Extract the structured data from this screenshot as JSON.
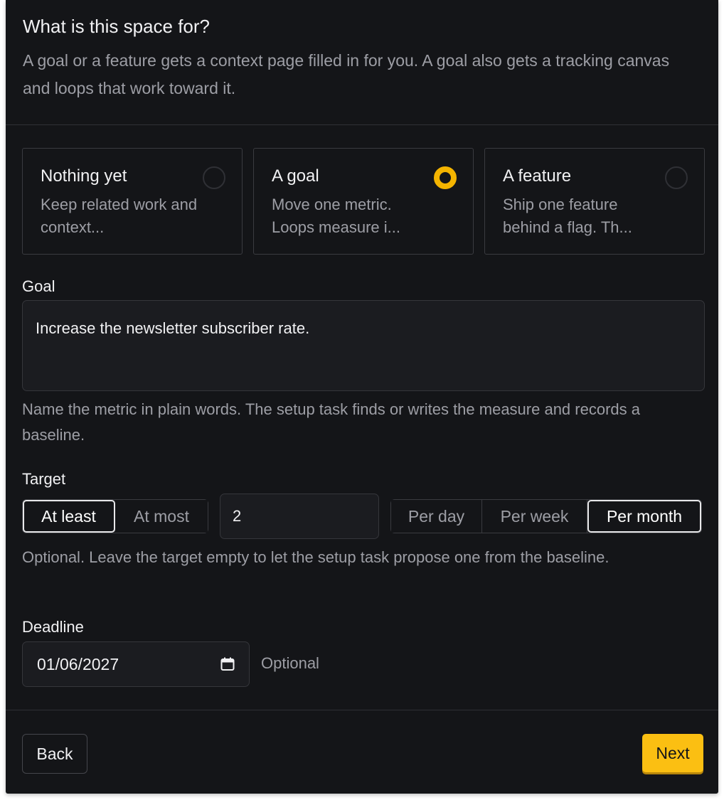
{
  "header": {
    "title": "What is this space for?",
    "subtitle": "A goal or a feature gets a context page filled in for you. A goal also gets a tracking canvas and loops that work toward it."
  },
  "options": [
    {
      "title": "Nothing yet",
      "desc": "Keep related work and context...",
      "selected": false
    },
    {
      "title": "A goal",
      "desc": "Move one metric. Loops measure i...",
      "selected": true
    },
    {
      "title": "A feature",
      "desc": "Ship one feature behind a flag. Th...",
      "selected": false
    }
  ],
  "goal": {
    "label": "Goal",
    "value": "Increase the newsletter subscriber rate.",
    "help": "Name the metric in plain words. The setup task finds or writes the measure and records a baseline."
  },
  "target": {
    "label": "Target",
    "comparators": [
      "At least",
      "At most"
    ],
    "selected_comparator": "At least",
    "value": "2",
    "periods": [
      "Per day",
      "Per week",
      "Per month"
    ],
    "selected_period": "Per month",
    "help": "Optional. Leave the target empty to let the setup task propose one from the baseline."
  },
  "deadline": {
    "label": "Deadline",
    "value": "01/06/2027",
    "note": "Optional"
  },
  "footer": {
    "back_label": "Back",
    "next_label": "Next"
  },
  "colors": {
    "accent": "#fbbf12",
    "background": "#141518"
  },
  "icons": {
    "calendar": "calendar-icon"
  }
}
